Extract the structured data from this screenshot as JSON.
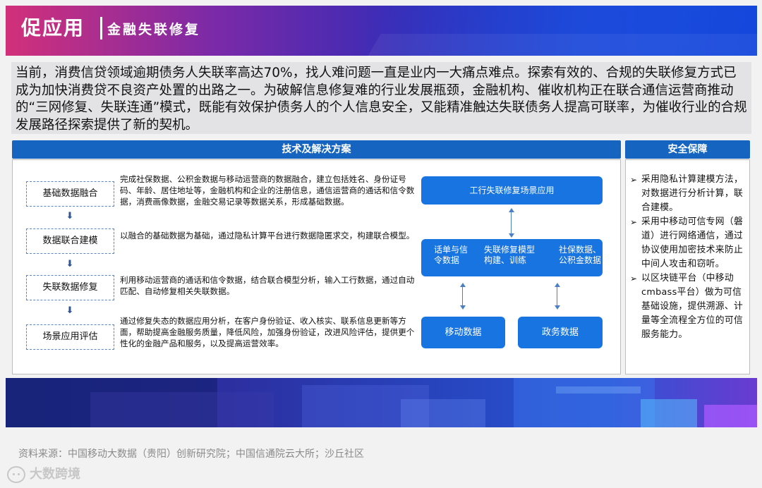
{
  "header": {
    "title": "促应用",
    "subtitle": "金融失联修复",
    "colors": {
      "from": "#d2307a",
      "to": "#1948d6"
    }
  },
  "intro": "当前，消费信贷领域逾期债务人失联率高达70%，找人难问题一直是业内一大痛点难点。探索有效的、合规的失联修复方式已成为加快消费贷不良资产处置的出路之一。为破解信息修复难的行业发展瓶颈，金融机构、催收机构正在联合通信运营商推动的“三网修复、失联连通”模式，既能有效保护债务人的个人信息安全，又能精准触达失联债务人提高可联率，为催收行业的合规发展路径探索提供了新的契机。",
  "solution": {
    "header": "技术及解决方案",
    "steps": [
      {
        "label": "基础数据融合",
        "desc": "完成社保数据、公积金数据与移动运营商的数据融合，建立包括姓名、身份证号码、年龄、居住地址等，金融机构和企业的注册信息，通信运营商的通话和信令数据，消费画像数据，金融交易记录等数据关系，形成基础数据。"
      },
      {
        "label": "数据联合建模",
        "desc": "以融合的基础数据为基础，通过隐私计算平台进行数据隐匿求交，构建联合模型。"
      },
      {
        "label": "失联数据修复",
        "desc": "利用移动运营商的通话和信令数据，结合联合模型分析，输入工行数据，通过自动匹配、自动修复相关失联数据。"
      },
      {
        "label": "场景应用评估",
        "desc": "通过修复失态的数据应用分析，在客户身份验证、收入核实、联系信息更新等方面，帮助提高金融服务质量，降低风险，加强身份验证，改进风险评估，提供更个性化的金融产品和服务，以及提高运营效率。"
      }
    ],
    "diagram": {
      "top": "工行失联修复场景应用",
      "middle": {
        "left": "话单与信令数据",
        "center": "失联修复模型构建、训练",
        "right": "社保数据、公积金数据"
      },
      "bottom_left": "移动数据",
      "bottom_right": "政务数据"
    }
  },
  "security": {
    "header": "安全保障",
    "items": [
      "采用隐私计算建模方法，对数据进行分析计算，联合建模。",
      "采用中移动可信专网（磐道）进行网络通信，通过协议使用加密技术来防止中间人攻击和窃听。",
      "以区块链平台（中移动cmbass平台）做为可信基础设施，提供溯源、计量等全流程全方位的可信服务能力。"
    ]
  },
  "source": "资料来源：中国移动大数据（贵阳）创新研究院；中国信通院云大所；沙丘社区",
  "logo": "大数跨境",
  "accent_color": "#1565c0"
}
